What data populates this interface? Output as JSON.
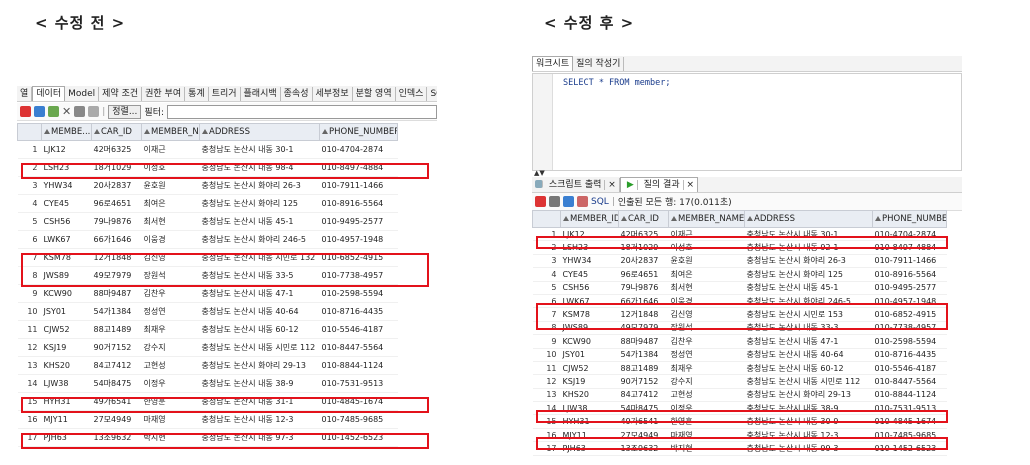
{
  "headings": {
    "before": "< 수정 전 >",
    "after": "< 수정 후 >"
  },
  "left": {
    "tabs": [
      "열",
      "데이터",
      "Model",
      "제약 조건",
      "권한 부여",
      "통계",
      "트리거",
      "플래시백",
      "종속성",
      "세부정보",
      "분할 영역",
      "인덱스",
      "SQL"
    ],
    "toolbar": {
      "sort_label": "정렬...",
      "filter_label": "필터:"
    },
    "columns": [
      "MEMBE...",
      "CAR_ID",
      "MEMBER_NAME",
      "ADDRESS",
      "PHONE_NUMBER"
    ],
    "rows": [
      [
        "1",
        "LJK12",
        "42머6325",
        "이재근",
        "충청남도 논산시 내동 30-1",
        "010-4704-2874"
      ],
      [
        "2",
        "LSH23",
        "18거1029",
        "이성호",
        "충청남도 논산시 내동 98-4",
        "010-8497-4884"
      ],
      [
        "3",
        "YHW34",
        "20사2837",
        "윤호원",
        "충청남도 논산시 화야리 26-3",
        "010-7911-1466"
      ],
      [
        "4",
        "CYE45",
        "96로4651",
        "최여은",
        "충청남도 논산시 화야리 125",
        "010-8916-5564"
      ],
      [
        "5",
        "CSH56",
        "79나9876",
        "최서현",
        "충청남도 논산시 내동 45-1",
        "010-9495-2577"
      ],
      [
        "6",
        "LWK67",
        "66가1646",
        "이웅경",
        "충청남도 논산시 화야리 246-5",
        "010-4957-1948"
      ],
      [
        "7",
        "KSM78",
        "12거1848",
        "김신영",
        "충청남도 논산시 내동 시민로 132",
        "010-6852-4915"
      ],
      [
        "8",
        "JWS89",
        "49모7979",
        "장원석",
        "충청남도 논산시 내동 33-5",
        "010-7738-4957"
      ],
      [
        "9",
        "KCW90",
        "88마9487",
        "김찬우",
        "충청남도 논산시 내동 47-1",
        "010-2598-5594"
      ],
      [
        "10",
        "JSY01",
        "54가1384",
        "정성연",
        "충청남도 논산시 내동 40-64",
        "010-8716-4435"
      ],
      [
        "11",
        "CJW52",
        "88고1489",
        "최재우",
        "충청남도 논산시 내동 60-12",
        "010-5546-4187"
      ],
      [
        "12",
        "KSJ19",
        "90거7152",
        "강수지",
        "충청남도 논산시 내동 시민로 112",
        "010-8447-5564"
      ],
      [
        "13",
        "KHS20",
        "84고7412",
        "고현성",
        "충청남도 논산시 화야리 29-13",
        "010-8844-1124"
      ],
      [
        "14",
        "LJW38",
        "54마8475",
        "이정우",
        "충청남도 논산시 내동 38-9",
        "010-7531-9513"
      ],
      [
        "15",
        "HYH31",
        "49가6541",
        "한영훈",
        "충청남도 논산시 내동 31-1",
        "010-4845-1674"
      ],
      [
        "16",
        "MJY11",
        "27모4949",
        "마재영",
        "충청남도 논산시 내동 12-3",
        "010-7485-9685"
      ],
      [
        "17",
        "PJH63",
        "13조9632",
        "박지현",
        "충청남도 논산시 내동 97-3",
        "010-1452-6523"
      ]
    ]
  },
  "right": {
    "top_tabs": [
      "워크시트",
      "질의 작성기"
    ],
    "sql_text": "SELECT * FROM member;",
    "output_tabs": [
      "스크립트 출력",
      "질의 결과"
    ],
    "toolbar": {
      "sql_label": "SQL",
      "status": "인출된 모든 행: 17(0.011초)"
    },
    "columns": [
      "MEMBER_ID",
      "CAR_ID",
      "MEMBER_NAME",
      "ADDRESS",
      "PHONE_NUMBER"
    ],
    "rows": [
      [
        "1",
        "LJK12",
        "42머6325",
        "이재근",
        "충청남도 논산시 내동 30-1",
        "010-4704-2874"
      ],
      [
        "2",
        "LSH23",
        "18거1029",
        "이성호",
        "충청남도 논산시 내동 92-1",
        "010-8497-4884"
      ],
      [
        "3",
        "YHW34",
        "20사2837",
        "윤호원",
        "충청남도 논산시 화야리 26-3",
        "010-7911-1466"
      ],
      [
        "4",
        "CYE45",
        "96로4651",
        "최여은",
        "충청남도 논산시 화야리 125",
        "010-8916-5564"
      ],
      [
        "5",
        "CSH56",
        "79나9876",
        "최서현",
        "충청남도 논산시 내동 45-1",
        "010-9495-2577"
      ],
      [
        "6",
        "LWK67",
        "66가1646",
        "이웅경",
        "충청남도 논산시 화야리 246-5",
        "010-4957-1948"
      ],
      [
        "7",
        "KSM78",
        "12거1848",
        "김신영",
        "충청남도 논산시 시민로 153",
        "010-6852-4915"
      ],
      [
        "8",
        "JWS89",
        "49모7979",
        "장원석",
        "충청남도 논산시 내동 33-3",
        "010-7738-4957"
      ],
      [
        "9",
        "KCW90",
        "88마9487",
        "김찬우",
        "충청남도 논산시 내동 47-1",
        "010-2598-5594"
      ],
      [
        "10",
        "JSY01",
        "54가1384",
        "정성연",
        "충청남도 논산시 내동 40-64",
        "010-8716-4435"
      ],
      [
        "11",
        "CJW52",
        "88고1489",
        "최재우",
        "충청남도 논산시 내동 60-12",
        "010-5546-4187"
      ],
      [
        "12",
        "KSJ19",
        "90거7152",
        "강수지",
        "충청남도 논산시 내동 시민로 112",
        "010-8447-5564"
      ],
      [
        "13",
        "KHS20",
        "84고7412",
        "고현성",
        "충청남도 논산시 화야리 29-13",
        "010-8844-1124"
      ],
      [
        "14",
        "LJW38",
        "54마8475",
        "이정우",
        "충청남도 논산시 내동 38-9",
        "010-7531-9513"
      ],
      [
        "15",
        "HYH31",
        "49가6541",
        "한영훈",
        "충청남도 논산시 내동 30-9",
        "010-4845-1674"
      ],
      [
        "16",
        "MJY11",
        "27모4949",
        "마재영",
        "충청남도 논산시 내동 12-3",
        "010-7485-9685"
      ],
      [
        "17",
        "PJH63",
        "13조9632",
        "박지현",
        "충청남도 논산시 내동 99-3",
        "010-1452-6523"
      ]
    ]
  },
  "colors": {
    "highlight": "#e3121b",
    "header_bg": "#e9edf3"
  }
}
